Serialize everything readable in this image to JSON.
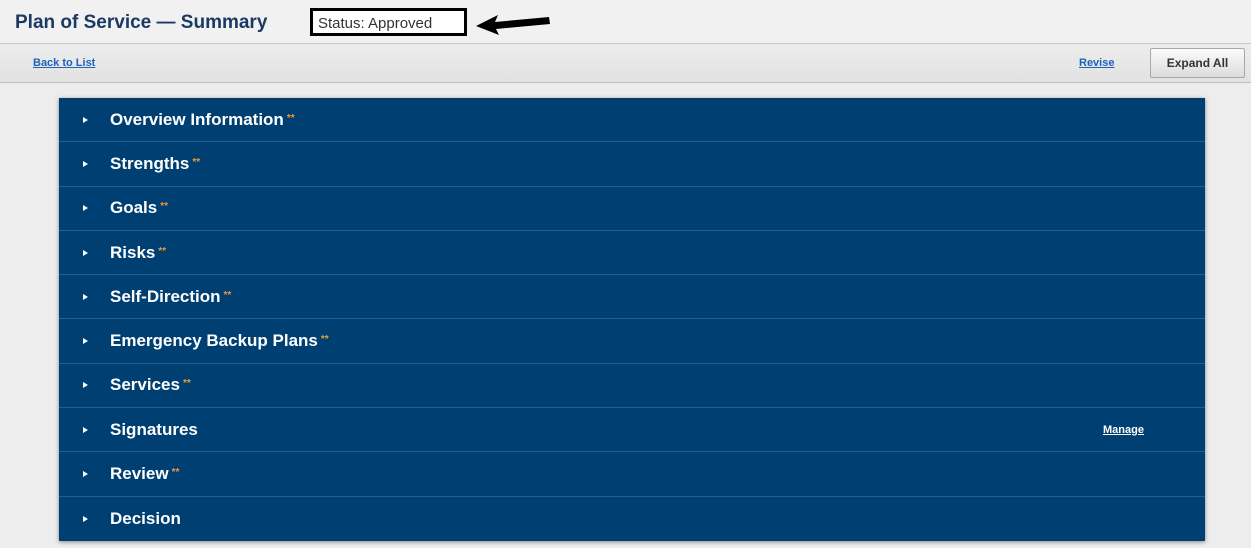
{
  "header": {
    "title": "Plan of Service — Summary",
    "status": "Status: Approved"
  },
  "toolbar": {
    "back_label": "Back to List",
    "revise_label": "Revise",
    "expand_label": "Expand All"
  },
  "required_marker": "**",
  "colors": {
    "panel_bg": "#003f72",
    "title_text": "#1a3a63",
    "link": "#1f63b8",
    "required_marker": "#e89a3c"
  },
  "sections": [
    {
      "label": "Overview Information",
      "required": true
    },
    {
      "label": "Strengths",
      "required": true
    },
    {
      "label": "Goals",
      "required": true
    },
    {
      "label": "Risks",
      "required": true
    },
    {
      "label": "Self-Direction",
      "required": true
    },
    {
      "label": "Emergency Backup Plans",
      "required": true
    },
    {
      "label": "Services",
      "required": true
    },
    {
      "label": "Signatures",
      "required": false,
      "action": "Manage"
    },
    {
      "label": "Review",
      "required": true
    },
    {
      "label": "Decision",
      "required": false
    }
  ]
}
